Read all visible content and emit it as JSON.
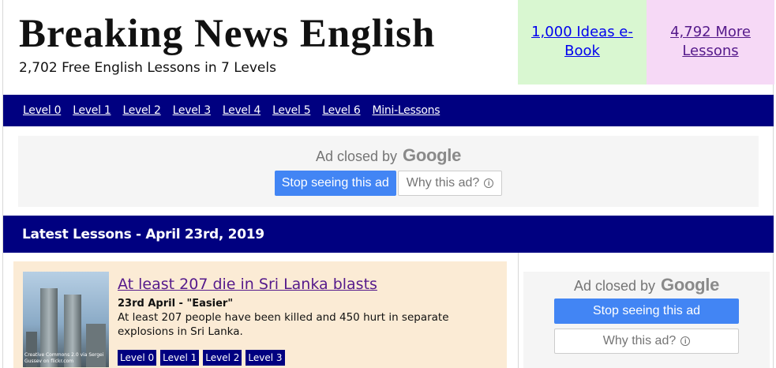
{
  "header": {
    "site_title": "Breaking News English",
    "tagline": "2,702 Free English Lessons in 7 Levels",
    "promo_ebook": "1,000 Ideas e-Book",
    "promo_more": "4,792 More Lessons"
  },
  "nav": {
    "items": [
      "Level 0",
      "Level 1",
      "Level 2",
      "Level 3",
      "Level 4",
      "Level 5",
      "Level 6",
      "Mini-Lessons"
    ]
  },
  "ads": {
    "closed_by": "Ad closed by",
    "google": "Google",
    "stop_label": "Stop seeing this ad",
    "why_label": "Why this ad?"
  },
  "latest": {
    "heading": "Latest Lessons - April 23rd, 2019"
  },
  "lessons": [
    {
      "title": "At least 207 die in Sri Lanka blasts",
      "date": "23rd April - \"Easier\"",
      "description": "At least 207 people have been killed and 450 hurt in separate explosions in Sri Lanka.",
      "image_credit": "Creative Commons 2.0 via Sergei Gussev on flickr.com",
      "levels": [
        "Level 0",
        "Level 1",
        "Level 2",
        "Level 3"
      ]
    }
  ],
  "colors": {
    "navy": "#000080",
    "google_blue": "#4285f4",
    "ebook_bg": "#d9f7d1",
    "more_bg": "#f6d9f6",
    "lesson_bg": "#fbebd5"
  }
}
